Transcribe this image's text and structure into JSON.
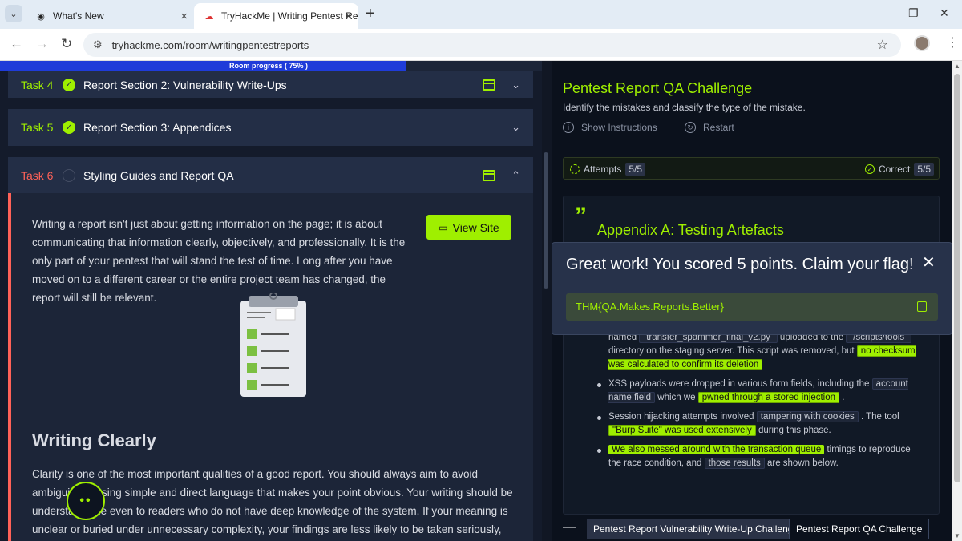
{
  "browser": {
    "tabs": [
      {
        "title": "What's New",
        "icon": "chrome-icon",
        "active": false
      },
      {
        "title": "TryHackMe | Writing Pentest Re",
        "icon": "tryhackme-icon",
        "active": true
      }
    ],
    "url": "tryhackme.com/room/writingpentestreports"
  },
  "room": {
    "progress_label": "Room progress ( 75% )",
    "progress_value": 75,
    "tasks": [
      {
        "number": "Task 4",
        "title": "Report Section 2: Vulnerability Write-Ups",
        "complete": true
      },
      {
        "number": "Task 5",
        "title": "Report Section 3: Appendices",
        "complete": true
      },
      {
        "number": "Task 6",
        "title": "Styling Guides and Report QA",
        "complete": false
      }
    ],
    "view_site_label": "View Site",
    "paragraph1": "Writing a report isn't just about getting information on the page; it is about communicating that information clearly, objectively, and professionally. It is the only part of your pentest that will stand the test of time. Long after you have moved on to a different career or the entire project team has changed, the report will still be relevant.",
    "heading": "Writing Clearly",
    "paragraph2": "Clarity is one of the most important qualities of a good report. You should always aim to avoid ambiguity by using simple and direct language that makes your point obvious. Your writing should be understandable even to readers who do not have deep knowledge of the system. If your meaning is unclear or buried under unnecessary complexity, your findings are less likely to be taken seriously, or"
  },
  "qa": {
    "title": "Pentest Report QA Challenge",
    "subtitle": "Identify the mistakes and classify the type of the mistake.",
    "show_instructions": "Show Instructions",
    "restart": "Restart",
    "attempts_label": "Attempts",
    "attempts_value": "5/5",
    "correct_label": "Correct",
    "correct_value": "5/5",
    "appendix_heading": "Appendix A: Testing Artefacts",
    "bullets": {
      "b1_pre": "named",
      "b1_code1": "`transfer_spammer_final_v2.py`",
      "b1_mid": "uploaded to the",
      "b1_code2": "`/scripts/tools`",
      "b1_mid2": "directory on the staging server. This script was removed, but",
      "b1_hl": "no checksum was calculated to confirm its deletion",
      "b2_pre": "XSS payloads were dropped in various form fields, including the",
      "b2_code": "account name field",
      "b2_mid": "which we",
      "b2_hl": "pwned through a stored injection",
      "b2_end": ".",
      "b3_pre": "Session hijacking attempts involved",
      "b3_code": "tampering with cookies",
      "b3_mid": ". The tool",
      "b3_hl": "\"Burp Suite\" was used extensively",
      "b3_end": "during this phase.",
      "b4_hl": "We also messed around with the transaction queue",
      "b4_mid": "timings to reproduce the race condition, and",
      "b4_code": "those results",
      "b4_end": "are shown below."
    },
    "modal_message": "Great work! You scored 5 points. Claim your flag!",
    "flag": "THM{QA.Makes.Reports.Better}",
    "bottom_tabs": [
      "Pentest Report Vulnerability Write-Up Challenge",
      "Pentest Report QA Challenge"
    ]
  },
  "colors": {
    "accent": "#9fef00",
    "danger": "#ff6258",
    "panel": "#232e46"
  }
}
